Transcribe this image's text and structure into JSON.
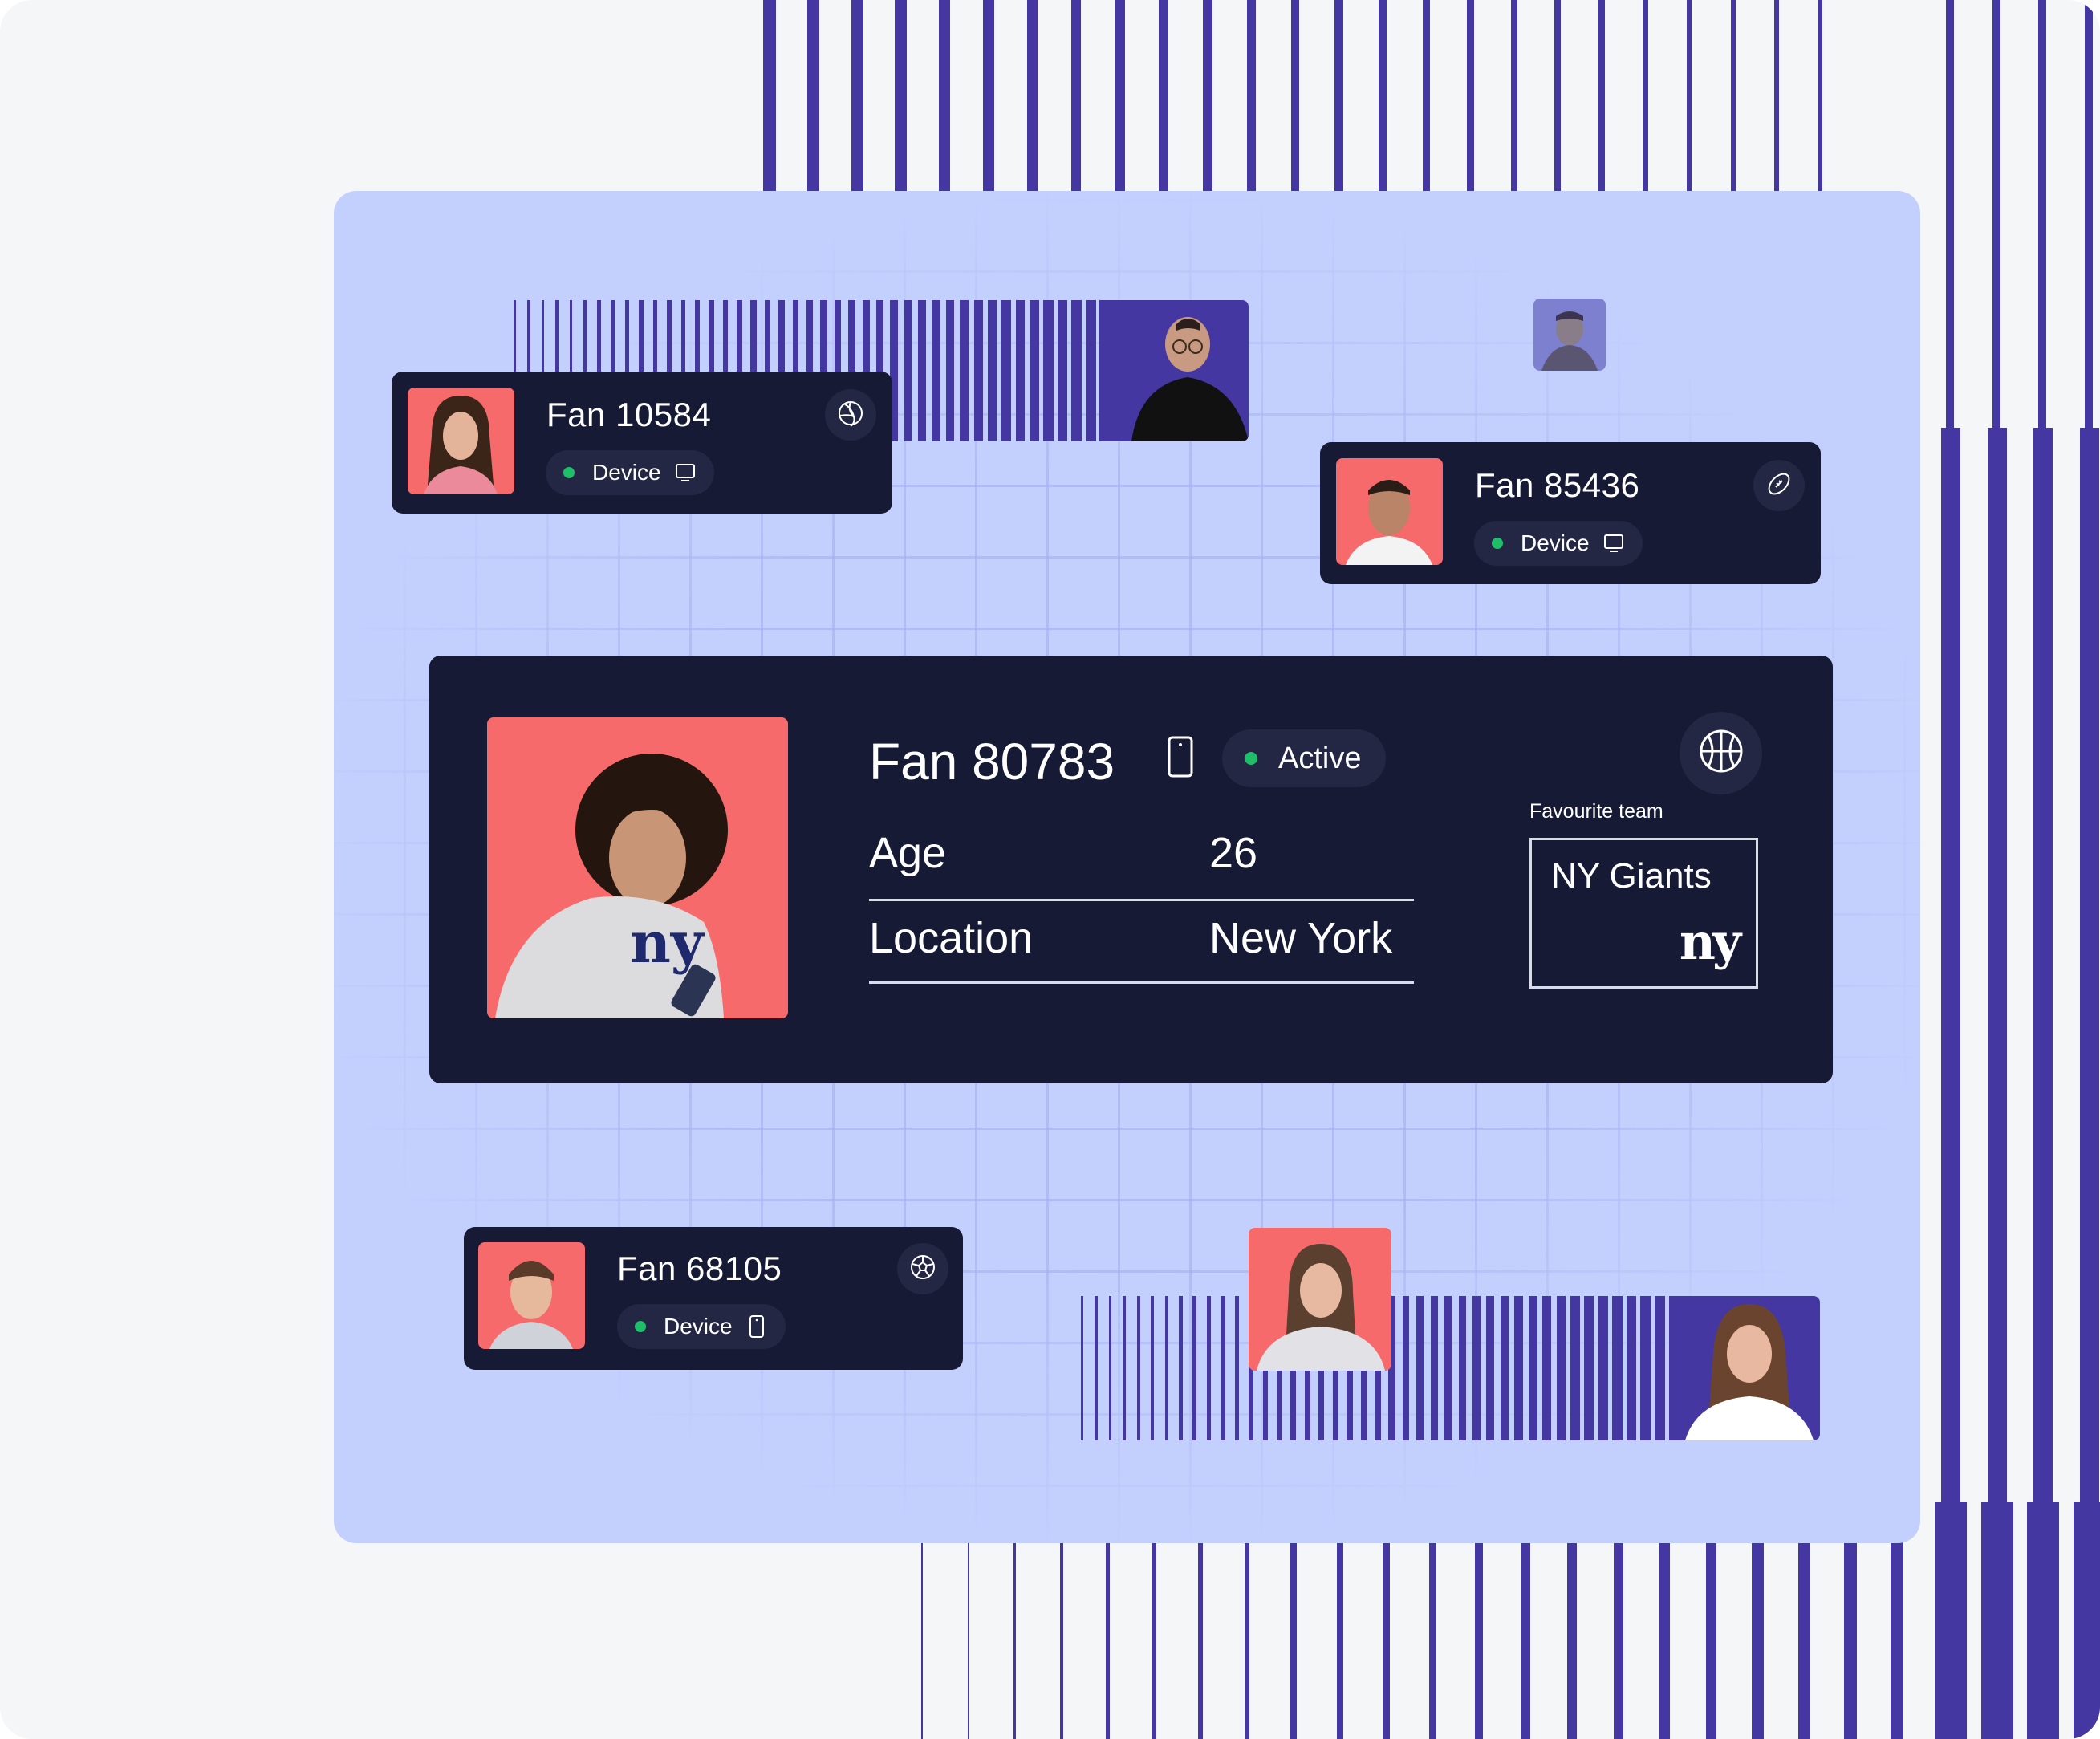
{
  "colors": {
    "page_background": "#f5f6f8",
    "stripe": "#4437a1",
    "panel": "#c3cffd",
    "card": "#161a35",
    "chip": "#232744",
    "status_dot": "#1fbf6a",
    "photo_coral": "#f76a6b"
  },
  "small_cards": [
    {
      "name": "Fan 10584",
      "device_label": "Device",
      "device_icon": "monitor-icon",
      "sport_icon": "volleyball-icon"
    },
    {
      "name": "Fan 85436",
      "device_label": "Device",
      "device_icon": "monitor-icon",
      "sport_icon": "american-football-icon"
    },
    {
      "name": "Fan 68105",
      "device_label": "Device",
      "device_icon": "smartphone-icon",
      "sport_icon": "soccer-ball-icon"
    }
  ],
  "main_card": {
    "name": "Fan 80783",
    "device_icon": "smartphone-icon",
    "status": "Active",
    "sport_icon": "basketball-icon",
    "rows": [
      {
        "label": "Age",
        "value": "26"
      },
      {
        "label": "Location",
        "value": "New York"
      }
    ],
    "favourite_team_label": "Favourite team",
    "team_name": "NY Giants",
    "team_logo_text": "ny"
  }
}
